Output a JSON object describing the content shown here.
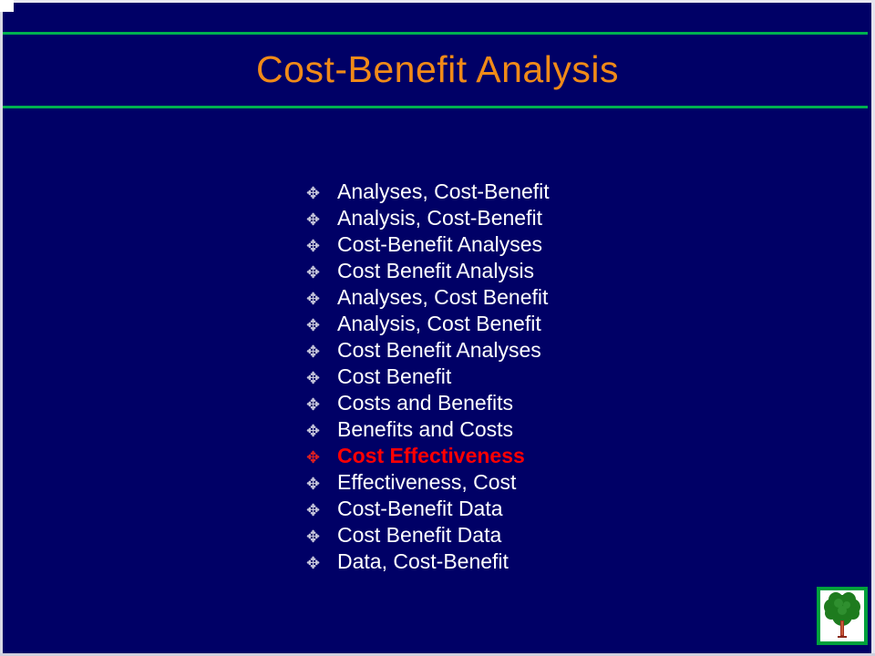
{
  "slide": {
    "title": "Cost-Benefit Analysis",
    "background_color": "#000066",
    "title_color": "#F08A18",
    "rule_color": "#00B050",
    "accent_color": "#FF0000",
    "text_color": "#FFFFFF",
    "bullet_glyph": "✥",
    "bullet_icon_name": "compass-diamond-bullet-icon",
    "items": [
      {
        "label": "Analyses, Cost-Benefit",
        "accent": false
      },
      {
        "label": "Analysis, Cost-Benefit",
        "accent": false
      },
      {
        "label": "Cost-Benefit Analyses",
        "accent": false
      },
      {
        "label": "Cost Benefit Analysis",
        "accent": false
      },
      {
        "label": "Analyses, Cost Benefit",
        "accent": false
      },
      {
        "label": "Analysis, Cost Benefit",
        "accent": false
      },
      {
        "label": "Cost Benefit Analyses",
        "accent": false
      },
      {
        "label": "Cost Benefit",
        "accent": false
      },
      {
        "label": "Costs and Benefits",
        "accent": false
      },
      {
        "label": "Benefits and Costs",
        "accent": false
      },
      {
        "label": "Cost Effectiveness",
        "accent": true
      },
      {
        "label": "Effectiveness, Cost",
        "accent": false
      },
      {
        "label": "Cost-Benefit Data",
        "accent": false
      },
      {
        "label": "Cost Benefit Data",
        "accent": false
      },
      {
        "label": "Data, Cost-Benefit",
        "accent": false
      }
    ],
    "logo": {
      "icon_name": "tree-logo-icon",
      "border_color": "#00A03C",
      "canopy_color": "#1E7B1E",
      "trunk_color": "#A03020"
    }
  }
}
